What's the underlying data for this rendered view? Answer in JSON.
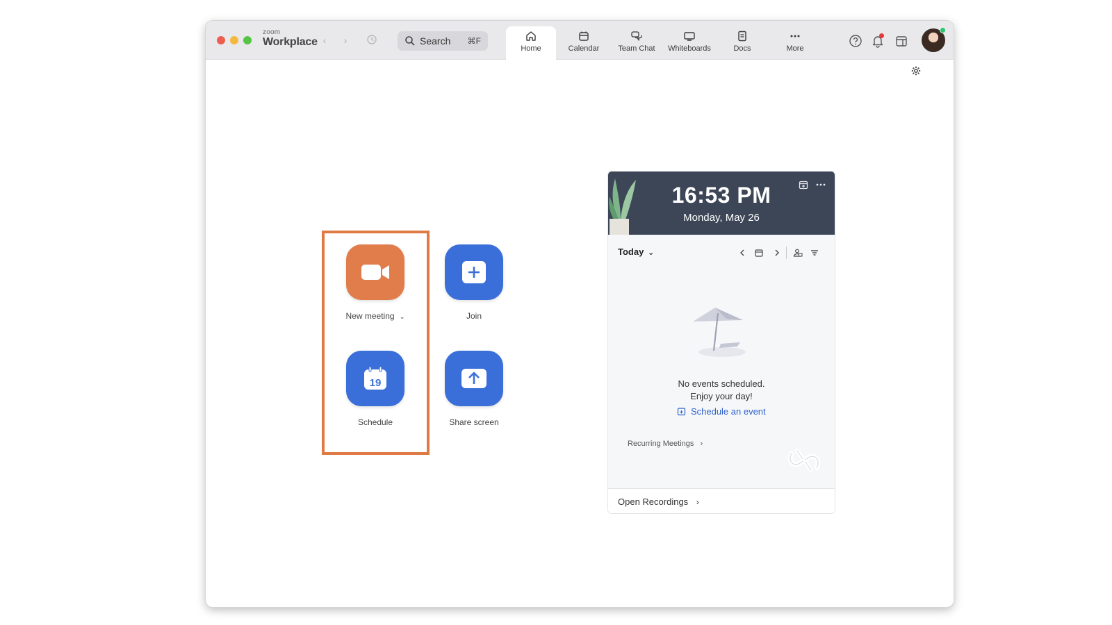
{
  "app": {
    "brand_small": "zoom",
    "brand_big": "Workplace"
  },
  "search": {
    "label": "Search",
    "shortcut": "⌘F"
  },
  "tabs": [
    {
      "label": "Home",
      "icon": "home-icon",
      "active": true
    },
    {
      "label": "Calendar",
      "icon": "calendar-icon",
      "active": false
    },
    {
      "label": "Team Chat",
      "icon": "chat-icon",
      "active": false
    },
    {
      "label": "Whiteboards",
      "icon": "whiteboard-icon",
      "active": false
    },
    {
      "label": "Docs",
      "icon": "docs-icon",
      "active": false
    },
    {
      "label": "More",
      "icon": "more-icon",
      "active": false
    }
  ],
  "actions": {
    "new_meeting": "New meeting",
    "join": "Join",
    "schedule": "Schedule",
    "schedule_day": "19",
    "share_screen": "Share screen"
  },
  "calendar_card": {
    "time": "16:53 PM",
    "date": "Monday, May 26",
    "today_label": "Today",
    "empty_line1": "No events scheduled.",
    "empty_line2": "Enjoy your day!",
    "schedule_link": "Schedule an event",
    "recurring": "Recurring Meetings",
    "open_recordings": "Open Recordings"
  },
  "colors": {
    "orange_action": "#e07d4a",
    "blue_action": "#3a6fd9",
    "highlight": "#e07a44",
    "card_header": "#3c4657",
    "link": "#2f62c9"
  }
}
